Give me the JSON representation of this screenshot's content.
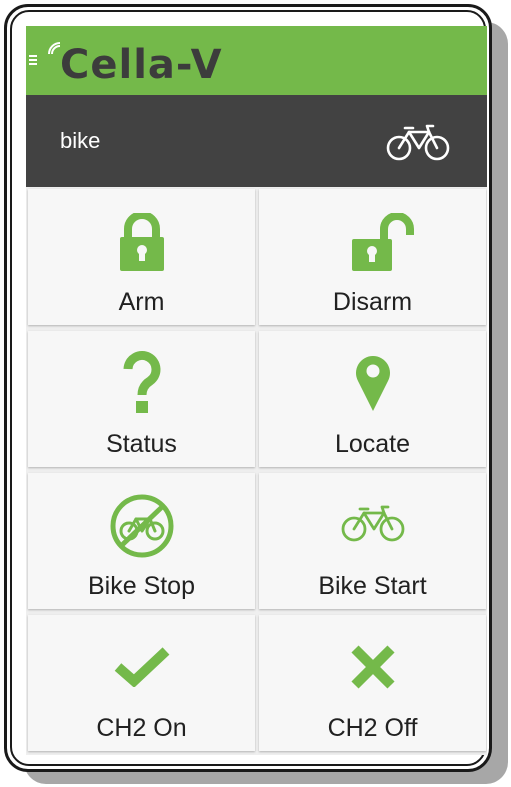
{
  "app": {
    "brand": "Cella-V",
    "accent_color": "#74b94a",
    "header_color": "#424242"
  },
  "device": {
    "name": "bike",
    "icon": "bicycle-icon"
  },
  "tiles": [
    {
      "label": "Arm",
      "icon": "locked-padlock-icon"
    },
    {
      "label": "Disarm",
      "icon": "unlocked-padlock-icon"
    },
    {
      "label": "Status",
      "icon": "question-mark-icon"
    },
    {
      "label": "Locate",
      "icon": "map-pin-icon"
    },
    {
      "label": "Bike Stop",
      "icon": "bike-prohibited-icon"
    },
    {
      "label": "Bike Start",
      "icon": "bicycle-icon"
    },
    {
      "label": "CH2 On",
      "icon": "checkmark-icon"
    },
    {
      "label": "CH2 Off",
      "icon": "x-mark-icon"
    }
  ]
}
